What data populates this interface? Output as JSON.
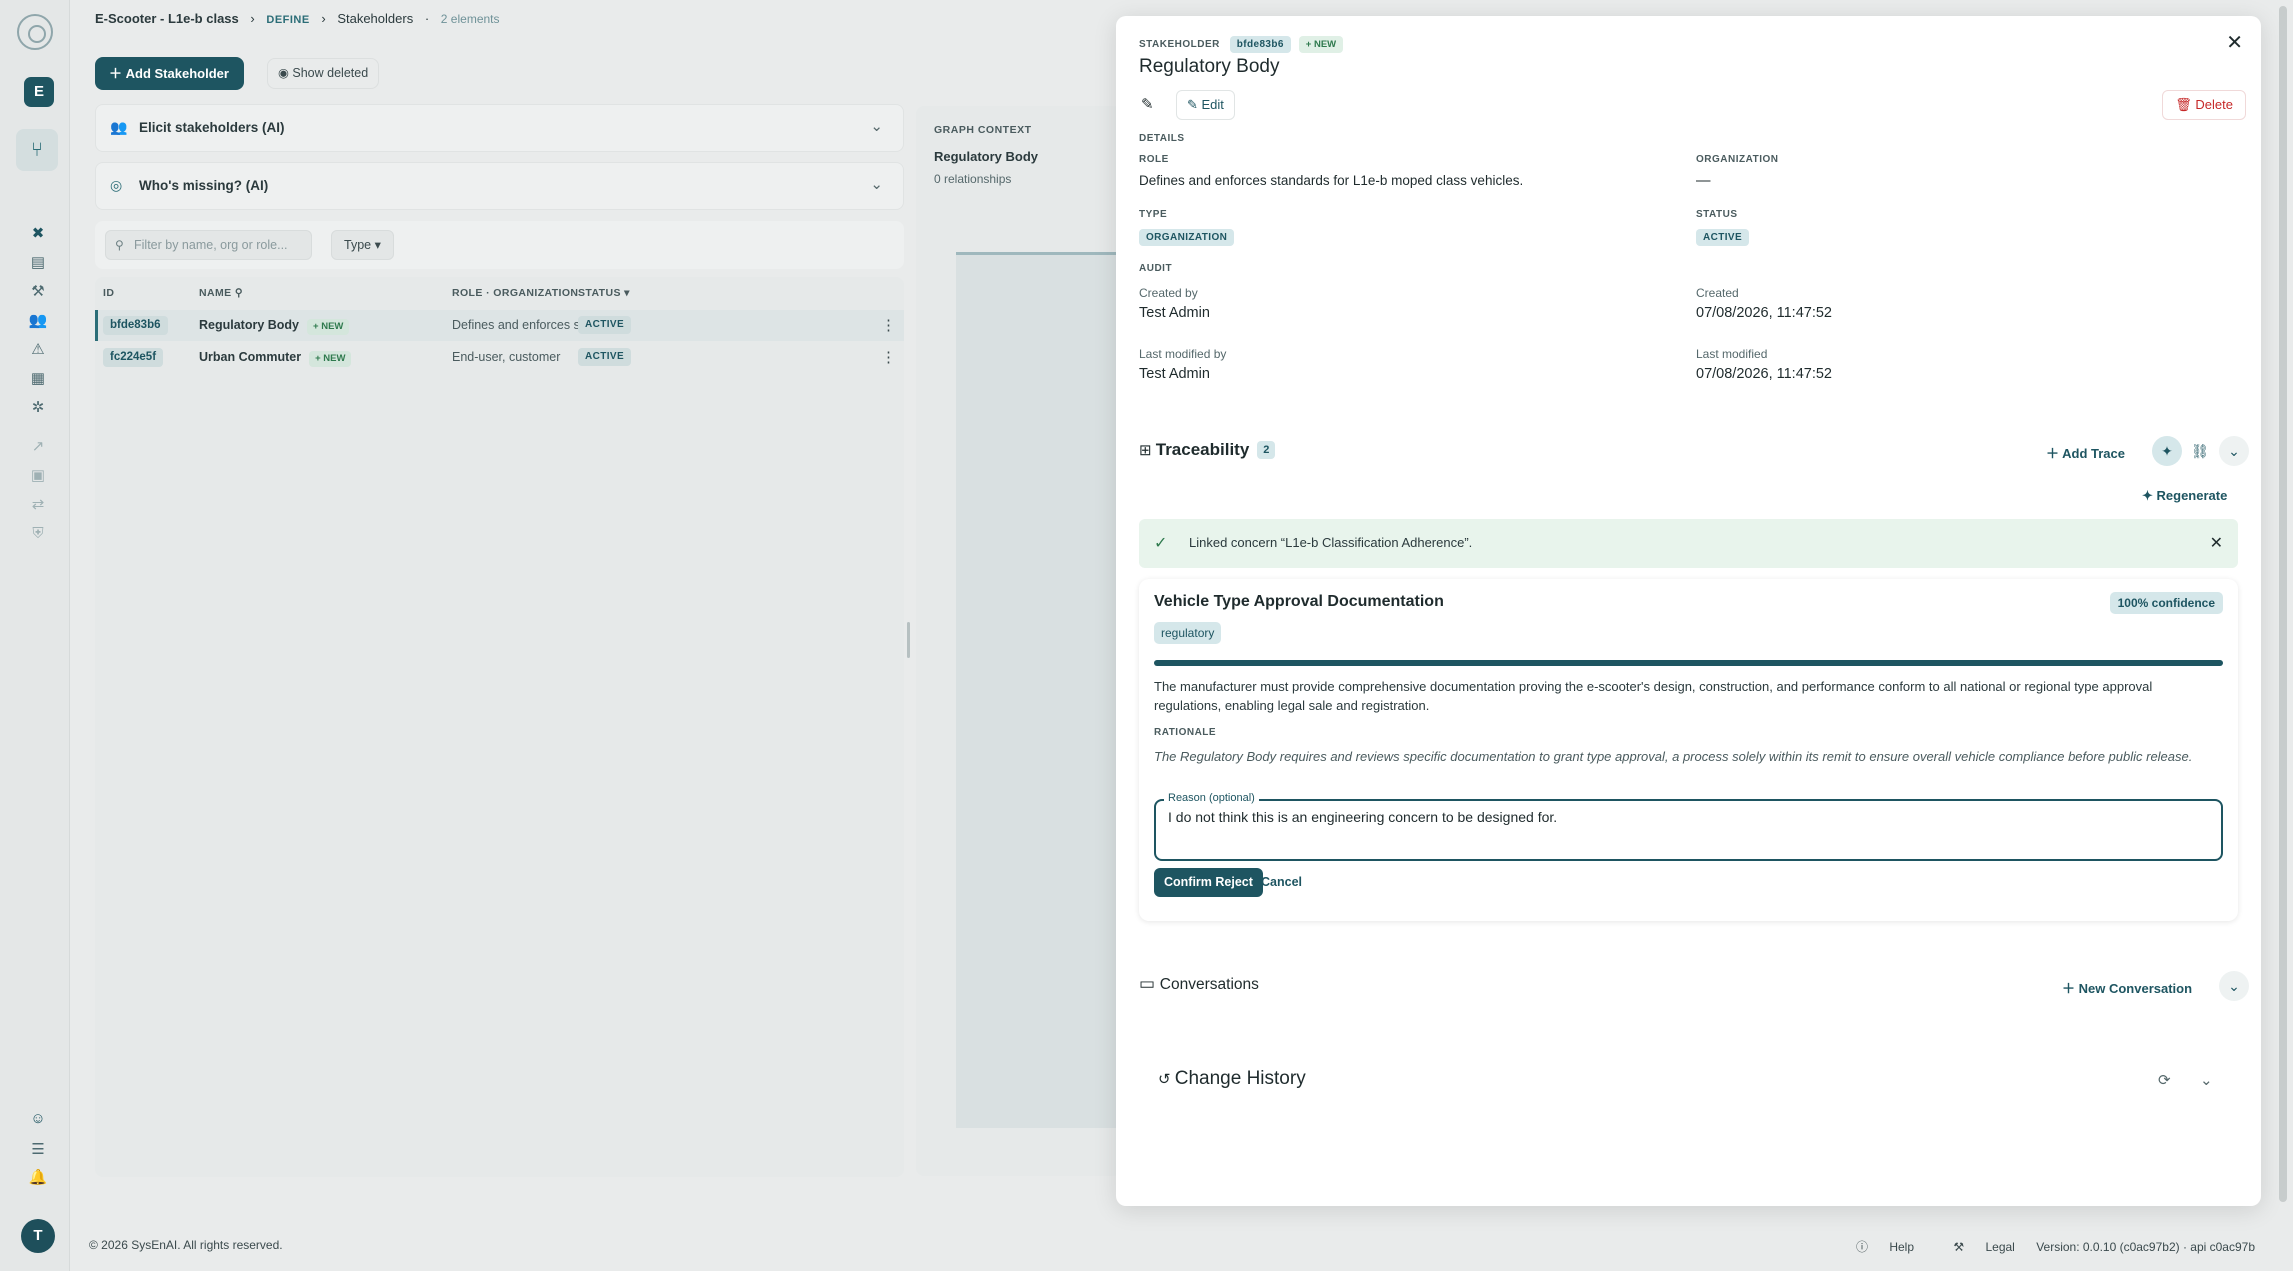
{
  "breadcrumb": {
    "project": "E-Scooter - L1e-b class",
    "phase": "DEFINE",
    "page": "Stakeholders",
    "count": "2 elements"
  },
  "workspace": {
    "initial": "E"
  },
  "user": {
    "initial": "T"
  },
  "toolbar": {
    "add_label": "Add Stakeholder",
    "show_deleted_label": "Show deleted"
  },
  "ai_panels": [
    {
      "label": "Elicit stakeholders (AI)"
    },
    {
      "label": "Who's missing? (AI)"
    }
  ],
  "filter": {
    "search_placeholder": "Filter by name, org or role...",
    "type_label": "Type"
  },
  "table": {
    "headers": {
      "id": "ID",
      "name": "NAME",
      "role": "ROLE · ORGANIZATION",
      "status": "STATUS"
    },
    "rows": [
      {
        "id": "bfde83b6",
        "name": "Regulatory Body",
        "new": "+ NEW",
        "role": "Defines and enforces stan...",
        "status": "ACTIVE"
      },
      {
        "id": "fc224e5f",
        "name": "Urban Commuter",
        "new": "+ NEW",
        "role": "End-user, customer",
        "status": "ACTIVE"
      }
    ]
  },
  "graph": {
    "heading": "GRAPH CONTEXT",
    "title": "Regulatory Body",
    "subtitle": "0 relationships"
  },
  "footer": {
    "copyright": "© 2026 SysEnAI. All rights reserved.",
    "help": "Help",
    "legal": "Legal",
    "version": "Version: 0.0.10 (c0ac97b2) · api c0ac97b"
  },
  "drawer": {
    "kind": "STAKEHOLDER",
    "id": "bfde83b6",
    "new_badge": "+ NEW",
    "title": "Regulatory Body",
    "edit_label": "Edit",
    "delete_label": "Delete",
    "details": {
      "heading": "DETAILS",
      "role_label": "ROLE",
      "role_value": "Defines and enforces standards for L1e-b moped class vehicles.",
      "org_label": "ORGANIZATION",
      "org_value": "—",
      "type_label": "TYPE",
      "type_value": "ORGANIZATION",
      "status_label": "STATUS",
      "status_value": "ACTIVE"
    },
    "audit": {
      "heading": "AUDIT",
      "created_by_label": "Created by",
      "created_by": "Test Admin",
      "created_label": "Created",
      "created": "07/08/2026, 11:47:52",
      "modified_by_label": "Last modified by",
      "modified_by": "Test Admin",
      "modified_label": "Last modified",
      "modified": "07/08/2026, 11:47:52"
    },
    "traceability": {
      "title": "Traceability",
      "count": "2",
      "add_trace": "Add Trace",
      "regenerate": "Regenerate",
      "success_message": "Linked concern “L1e-b Classification Adherence”."
    },
    "suggestion": {
      "title": "Vehicle Type Approval Documentation",
      "confidence": "100% confidence",
      "confidence_value": 1.0,
      "tag": "regulatory",
      "description": "The manufacturer must provide comprehensive documentation proving the e-scooter's design, construction, and performance conform to all national or regional type approval regulations, enabling legal sale and registration.",
      "rationale_label": "RATIONALE",
      "rationale": "The Regulatory Body requires and reviews specific documentation to grant type approval, a process solely within its remit to ensure overall vehicle compliance before public release.",
      "reason_label": "Reason (optional)",
      "reason_value": "I do not think this is an engineering concern to be designed for.",
      "confirm_label": "Confirm Reject",
      "cancel_label": "Cancel"
    },
    "conversations": {
      "title": "Conversations",
      "new_label": "New Conversation"
    },
    "history": {
      "title": "Change History"
    }
  }
}
